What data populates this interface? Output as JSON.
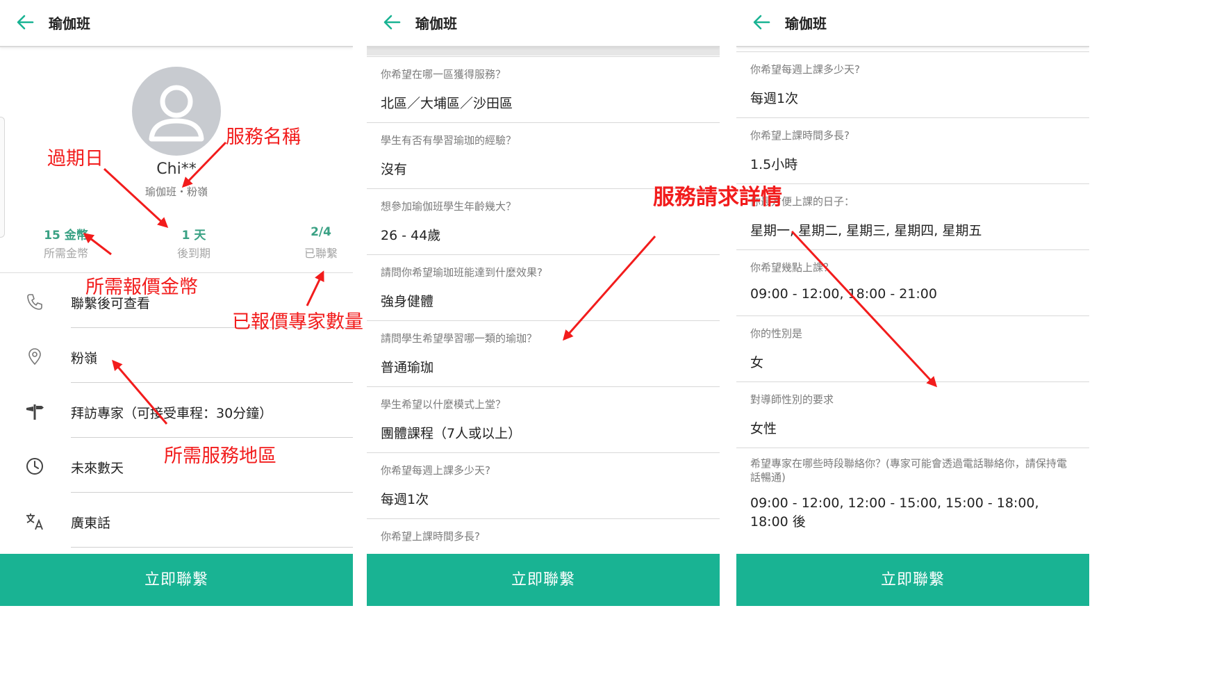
{
  "screens": [
    {
      "title": "瑜伽班",
      "client": {
        "name": "Chi**",
        "subtitle": "瑜伽班・粉嶺"
      },
      "stats": [
        {
          "value": "15 金幣",
          "label": "所需金幣"
        },
        {
          "value": "1 天",
          "label": "後到期"
        },
        {
          "value": "2/4",
          "label": "已聯繫"
        }
      ],
      "info_rows": [
        {
          "icon": "phone-icon",
          "text": "聯繫後可查看"
        },
        {
          "icon": "location-pin-icon",
          "text": "粉嶺"
        },
        {
          "icon": "signpost-icon",
          "text": "拜訪專家（可接受車程：30分鐘）"
        },
        {
          "icon": "clock-icon",
          "text": "未來數天"
        },
        {
          "icon": "translate-icon",
          "text": "廣東話"
        }
      ],
      "cta_label": "立即聯繫"
    },
    {
      "title": "瑜伽班",
      "questions": [
        {
          "q": "你希望在哪一區獲得服務？",
          "a": "北區／大埔區／沙田區"
        },
        {
          "q": "學生有否有學習瑜珈的經驗？",
          "a": "沒有"
        },
        {
          "q": "想參加瑜伽班學生年齡幾大？",
          "a": "26 - 44歲"
        },
        {
          "q": "請問你希望瑜珈班能達到什麼效果?",
          "a": "強身健體"
        },
        {
          "q": "請問學生希望學習哪一類的瑜珈？",
          "a": "普通瑜珈"
        },
        {
          "q": "學生希望以什麼模式上堂？",
          "a": "團體課程（7人或以上）"
        },
        {
          "q": "你希望每週上課多少天?",
          "a": "每週1次"
        },
        {
          "q": "你希望上課時間多長?",
          "a": ""
        }
      ],
      "cta_label": "立即聯繫"
    },
    {
      "title": "瑜伽班",
      "questions": [
        {
          "q": "你希望每週上課多少天?",
          "a": "每週1次"
        },
        {
          "q": "你希望上課時間多長?",
          "a": "1.5小時"
        },
        {
          "q": "你最方便上課的日子：",
          "a": "星期一, 星期二, 星期三, 星期四, 星期五"
        },
        {
          "q": "你希望幾點上課？",
          "a": "09:00 - 12:00, 18:00 - 21:00"
        },
        {
          "q": "你的性別是",
          "a": "女"
        },
        {
          "q": "對導師性別的要求",
          "a": "女性"
        },
        {
          "q": "希望專家在哪些時段聯絡你？(專家可能會透過電話聯絡你，請保持電話暢通)",
          "a": "09:00 - 12:00, 12:00 - 15:00, 15:00 - 18:00, 18:00 後"
        }
      ],
      "cta_label": "立即聯繫"
    }
  ],
  "annotations": {
    "service_name": "服務名稱",
    "expiry_date": "過期日",
    "required_coins": "所需報價金幣",
    "quoted_experts": "已報價專家數量",
    "service_area": "所需服務地區",
    "request_details": "服務請求詳情"
  },
  "colors": {
    "accent": "#19b393",
    "stat_green": "#3aa184",
    "annotation_red": "#f21c1c"
  }
}
